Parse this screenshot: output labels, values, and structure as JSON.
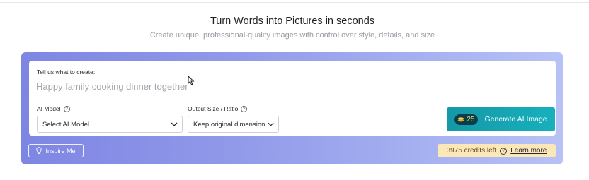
{
  "hero": {
    "title": "Turn Words into Pictures in seconds",
    "subtitle": "Create unique, professional-quality images with control over style, details, and size"
  },
  "prompt": {
    "label": "Tell us what to create:",
    "placeholder": "Happy family cooking dinner together",
    "value": ""
  },
  "ai_model": {
    "label": "AI Model",
    "help_icon": "?",
    "selected": "Select AI Model"
  },
  "output_size": {
    "label": "Output Size / Ratio",
    "help_icon": "?",
    "selected": "Keep original dimension"
  },
  "generate": {
    "credit_cost": "25",
    "label": "Generate AI Image",
    "icon": "coin-stack-icon"
  },
  "inspire": {
    "label": "Inspire Me",
    "icon": "lightbulb-icon"
  },
  "credits": {
    "text": "3975 credits left",
    "help_icon": "?",
    "learn_more": "Learn more"
  },
  "colors": {
    "accent_teal": "#17b0bd",
    "panel_gradient_start": "#7e86e4",
    "panel_gradient_end": "#b7c2f6",
    "credits_bg": "#fbe7b8"
  }
}
